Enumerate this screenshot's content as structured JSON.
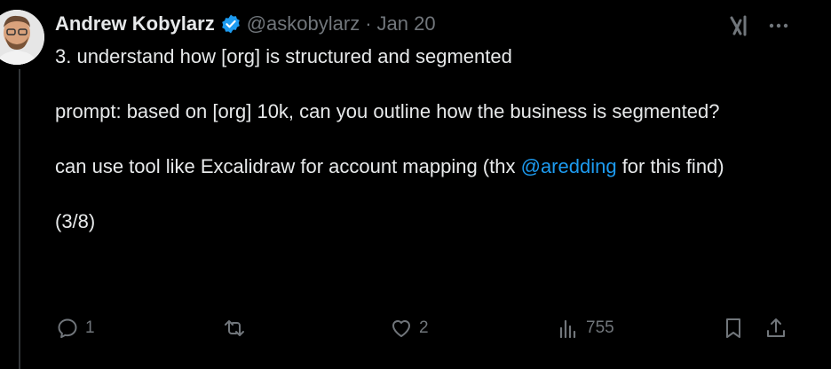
{
  "tweet": {
    "author": {
      "display_name": "Andrew Kobylarz",
      "handle": "@askobylarz",
      "verified": true,
      "avatar_icon": "avatar-photo"
    },
    "separator": "·",
    "date": "Jan 20",
    "body": {
      "line1": "3. understand how [org] is structured and segmented",
      "line2": "prompt: based on [org] 10k, can you outline how the business is segmented?",
      "line3_before": "can use tool like Excalidraw for account mapping (thx ",
      "mention": "@aredding",
      "line3_after": " for this find)",
      "line4": "(3/8)"
    },
    "actions": {
      "replies": "1",
      "retweets": "",
      "likes": "2",
      "views": "755"
    }
  },
  "colors": {
    "background": "#000000",
    "text": "#e7e9ea",
    "muted": "#71767b",
    "link": "#1d9bf0",
    "verified": "#1d9bf0"
  }
}
